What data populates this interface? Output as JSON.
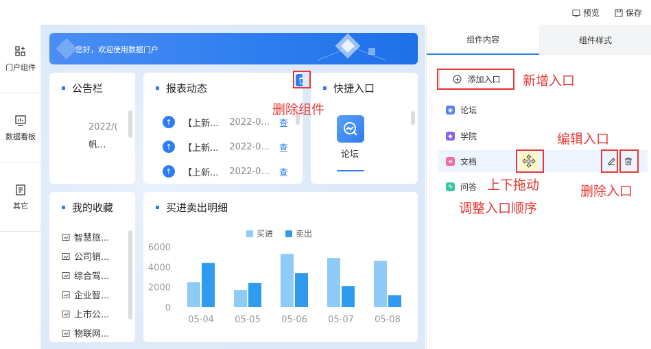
{
  "topbar": {
    "preview_label": "预览",
    "save_label": "保存"
  },
  "leftnav": {
    "items": [
      {
        "label": "门户组件",
        "icon": "grid-add-icon"
      },
      {
        "label": "数据看板",
        "icon": "board-icon"
      },
      {
        "label": "其它",
        "icon": "doc-icon"
      }
    ]
  },
  "banner": {
    "text": "您好，欢迎使用数据门户"
  },
  "cards": {
    "notice": {
      "title": "公告栏",
      "date": "2022/(",
      "text": "帆..."
    },
    "report": {
      "title": "报表动态",
      "rows": [
        {
          "title": "【上新...",
          "date": "2022-0...",
          "link": "查"
        },
        {
          "title": "【上新...",
          "date": "2022-0...",
          "link": "查"
        },
        {
          "title": "【上新...",
          "date": "2022-0...",
          "link": "查"
        }
      ]
    },
    "quick": {
      "title": "快捷入口",
      "item_label": "论坛"
    },
    "favorites": {
      "title": "我的收藏",
      "items": [
        "智慧旅...",
        "公司销...",
        "综合驾...",
        "企业智...",
        "上市公...",
        "物联网..."
      ]
    },
    "trade": {
      "title": "买进卖出明细"
    }
  },
  "chart_data": {
    "type": "bar",
    "categories": [
      "05-04",
      "05-05",
      "05-06",
      "05-07",
      "05-08"
    ],
    "series": [
      {
        "name": "买进",
        "values": [
          2500,
          1700,
          5300,
          4900,
          4600
        ],
        "color": "#8fcbf7"
      },
      {
        "name": "卖出",
        "values": [
          4400,
          2400,
          3400,
          2100,
          1200
        ],
        "color": "#2f9bef"
      }
    ],
    "y_ticks": [
      "6000",
      "4000",
      "2000",
      "0"
    ],
    "ylim": [
      0,
      6000
    ],
    "legend": "top-center"
  },
  "rightpanel": {
    "tabs": [
      {
        "label": "组件内容"
      },
      {
        "label": "组件样式"
      }
    ],
    "add_label": "添加入口",
    "entries": [
      {
        "label": "论坛",
        "color": "#5a7ff0"
      },
      {
        "label": "学院",
        "color": "#8a63e6"
      },
      {
        "label": "文档",
        "color": "#ef6fa5"
      },
      {
        "label": "问答",
        "color": "#3fc6a0"
      }
    ]
  },
  "annotations": {
    "delete_component": "删除组件",
    "add_entry": "新增入口",
    "edit_entry": "编辑入口",
    "drag": "上下拖动",
    "reorder": "调整入口顺序",
    "delete_entry": "删除入口"
  }
}
